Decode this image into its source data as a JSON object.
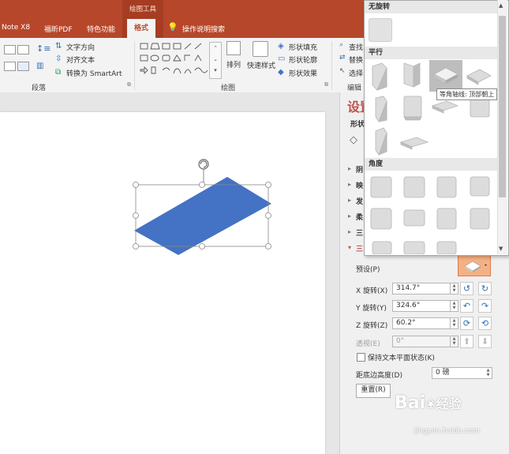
{
  "tabs": {
    "tab1": "Note X8",
    "tab2": "福昕PDF",
    "tab3": "特色功能",
    "contextual_group": "绘图工具",
    "active_tab": "格式",
    "tell_me": "操作说明搜索"
  },
  "ribbon": {
    "paragraph": {
      "text_direction": "文字方向",
      "align_text": "对齐文本",
      "convert_smartart": "转换为 SmartArt",
      "group_label": "段落"
    },
    "drawing": {
      "arrange": "排列",
      "quick_styles": "快速样式",
      "shape_fill": "形状填充",
      "shape_outline": "形状轮廓",
      "shape_effects": "形状效果",
      "group_label": "绘图"
    },
    "editing": {
      "find": "查找",
      "replace": "替换",
      "select": "选择",
      "group_label": "编辑"
    }
  },
  "pane": {
    "title": "设置",
    "subtitle": "形状",
    "sections": [
      "阴",
      "映",
      "发",
      "柔",
      "三",
      "三"
    ],
    "preset_label": "预设(P)",
    "x_rotation_label": "X 旋转(X)",
    "x_rotation_value": "314.7°",
    "y_rotation_label": "Y 旋转(Y)",
    "y_rotation_value": "324.6°",
    "z_rotation_label": "Z 旋转(Z)",
    "z_rotation_value": "60.2°",
    "perspective_label": "透视(E)",
    "perspective_value": "0°",
    "keep_flat_label": "保持文本平面状态(K)",
    "distance_label": "距底边高度(D)",
    "distance_value": "0 磅",
    "reset_label": "重置(R)"
  },
  "gallery": {
    "no_rotation": "无旋转",
    "parallel": "平行",
    "perspective": "角度",
    "tooltip": "等角轴线: 顶部朝上"
  },
  "colors": {
    "accent": "#b7472a",
    "shape_fill": "#4472c4"
  },
  "watermark": {
    "brand": "Bai",
    "brand2": "经验",
    "url": "jingyan.baidu.com"
  }
}
